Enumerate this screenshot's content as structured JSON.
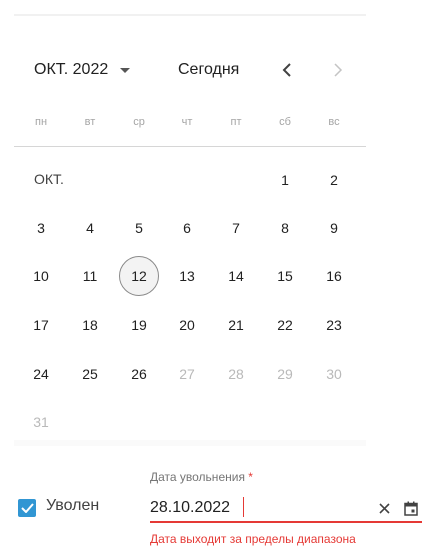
{
  "datepicker": {
    "month_year_label": "ОКТ. 2022",
    "today_label": "Сегодня",
    "weekdays": [
      "пн",
      "вт",
      "ср",
      "чт",
      "пт",
      "сб",
      "вс"
    ],
    "month_label": "ОКТ.",
    "days": [
      {
        "label": "1",
        "disabled": false
      },
      {
        "label": "2",
        "disabled": false
      },
      {
        "label": "3",
        "disabled": false
      },
      {
        "label": "4",
        "disabled": false
      },
      {
        "label": "5",
        "disabled": false
      },
      {
        "label": "6",
        "disabled": false
      },
      {
        "label": "7",
        "disabled": false
      },
      {
        "label": "8",
        "disabled": false
      },
      {
        "label": "9",
        "disabled": false
      },
      {
        "label": "10",
        "disabled": false
      },
      {
        "label": "11",
        "disabled": false
      },
      {
        "label": "12",
        "disabled": false,
        "selected": true
      },
      {
        "label": "13",
        "disabled": false
      },
      {
        "label": "14",
        "disabled": false
      },
      {
        "label": "15",
        "disabled": false
      },
      {
        "label": "16",
        "disabled": false
      },
      {
        "label": "17",
        "disabled": false
      },
      {
        "label": "18",
        "disabled": false
      },
      {
        "label": "19",
        "disabled": false
      },
      {
        "label": "20",
        "disabled": false
      },
      {
        "label": "21",
        "disabled": false
      },
      {
        "label": "22",
        "disabled": false
      },
      {
        "label": "23",
        "disabled": false
      },
      {
        "label": "24",
        "disabled": false
      },
      {
        "label": "25",
        "disabled": false
      },
      {
        "label": "26",
        "disabled": false
      },
      {
        "label": "27",
        "disabled": true
      },
      {
        "label": "28",
        "disabled": true
      },
      {
        "label": "29",
        "disabled": true
      },
      {
        "label": "30",
        "disabled": true
      },
      {
        "label": "31",
        "disabled": true
      }
    ]
  },
  "form": {
    "checkbox_label": "Уволен",
    "checkbox_checked": true,
    "dismissal_label": "Дата увольнения",
    "required_mark": "*",
    "dismissal_value": "28.10.2022",
    "error_text": "Дата выходит за пределы диапазона"
  },
  "colors": {
    "accent": "#3196d3",
    "error": "#e53935",
    "disabled_text": "#b9b9b9"
  }
}
